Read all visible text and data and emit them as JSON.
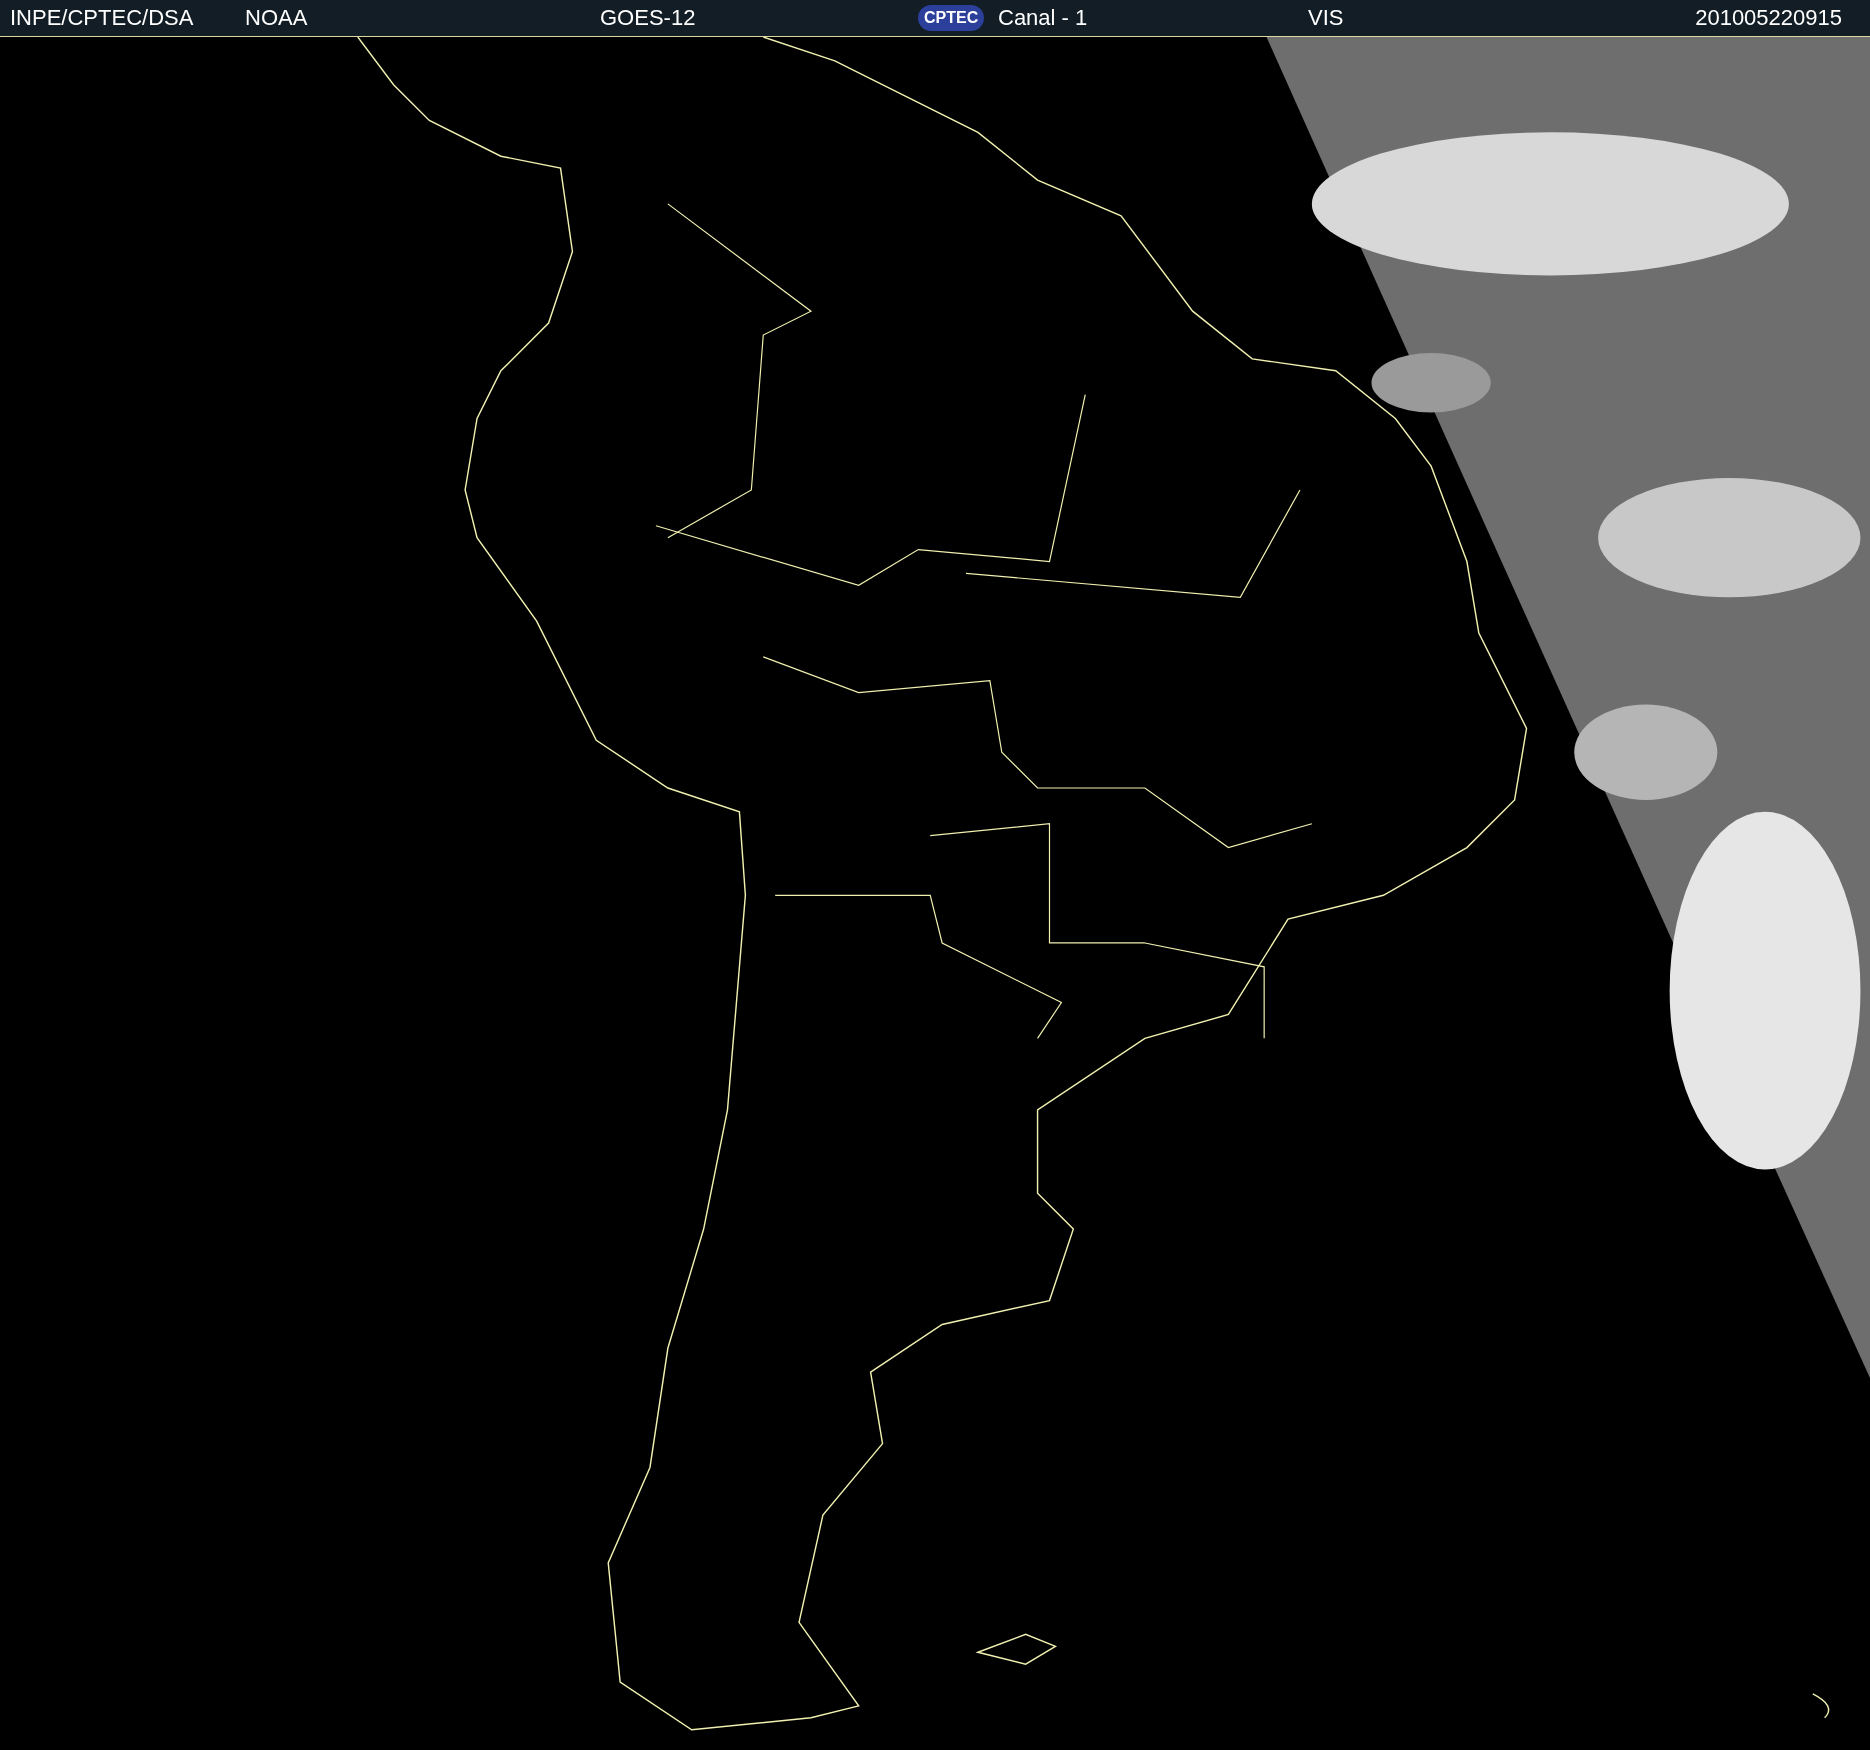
{
  "header": {
    "agency": "INPE/CPTEC/DSA",
    "source": "NOAA",
    "satellite": "GOES-12",
    "logo": "CPTEC",
    "channel": "Canal - 1",
    "band": "VIS",
    "timestamp": "201005220915"
  }
}
